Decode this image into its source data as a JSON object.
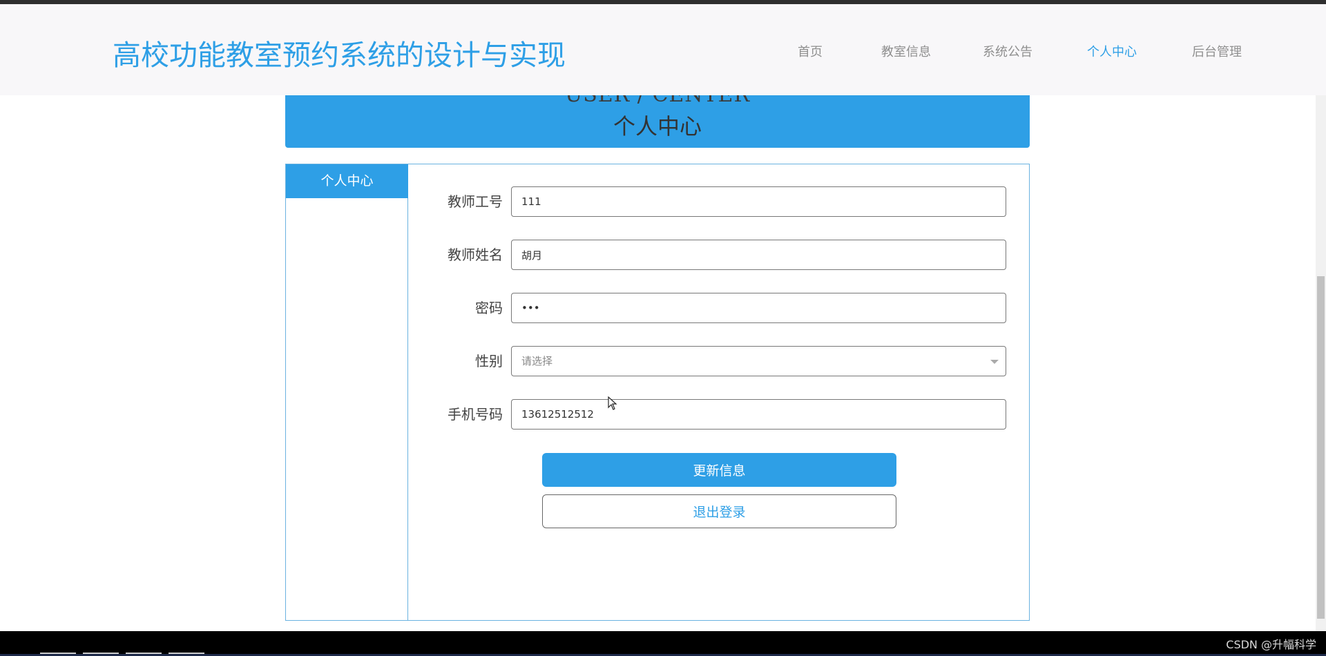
{
  "header": {
    "site_title": "高校功能教室预约系统的设计与实现",
    "nav": [
      {
        "label": "首页",
        "active": false
      },
      {
        "label": "教室信息",
        "active": false
      },
      {
        "label": "系统公告",
        "active": false
      },
      {
        "label": "个人中心",
        "active": true
      },
      {
        "label": "后台管理",
        "active": false
      }
    ]
  },
  "banner": {
    "title_en": "USER / CENTER",
    "title_cn": "个人中心"
  },
  "sidebar": {
    "items": [
      {
        "label": "个人中心",
        "active": true
      }
    ]
  },
  "form": {
    "fields": {
      "teacher_id": {
        "label": "教师工号",
        "value": "111"
      },
      "teacher_name": {
        "label": "教师姓名",
        "value": "胡月"
      },
      "password": {
        "label": "密码",
        "value": "•••"
      },
      "gender": {
        "label": "性别",
        "placeholder": "请选择"
      },
      "phone": {
        "label": "手机号码",
        "value": "13612512512"
      }
    },
    "update_button": "更新信息",
    "logout_button": "退出登录"
  },
  "footer": {
    "watermark": "CSDN @升幅科学"
  },
  "colors": {
    "accent": "#2e9fe6",
    "nav_background": "#f8f7f9",
    "box_border": "#6ab2e0"
  }
}
